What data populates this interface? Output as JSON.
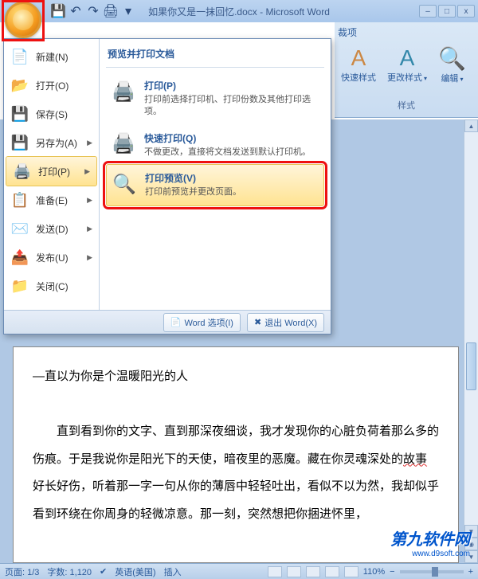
{
  "window": {
    "title": "如果你又是一抹回忆.docx - Microsoft Word"
  },
  "ribbon": {
    "tab_label": "裁项",
    "quick_styles": "快速样式",
    "change_styles": "更改样式",
    "edit": "编辑",
    "group_label": "样式"
  },
  "office_menu": {
    "items": [
      {
        "label": "新建(N)",
        "icon": "new-doc-icon"
      },
      {
        "label": "打开(O)",
        "icon": "open-folder-icon"
      },
      {
        "label": "保存(S)",
        "icon": "save-icon"
      },
      {
        "label": "另存为(A)",
        "icon": "save-as-icon"
      },
      {
        "label": "打印(P)",
        "icon": "print-icon"
      },
      {
        "label": "准备(E)",
        "icon": "prepare-icon"
      },
      {
        "label": "发送(D)",
        "icon": "send-icon"
      },
      {
        "label": "发布(U)",
        "icon": "publish-icon"
      },
      {
        "label": "关闭(C)",
        "icon": "close-doc-icon"
      }
    ],
    "right_header": "预览并打印文档",
    "sub_items": [
      {
        "title": "打印(P)",
        "desc": "打印前选择打印机、打印份数及其他打印选项。"
      },
      {
        "title": "快速打印(Q)",
        "desc": "不做更改，直接将文档发送到默认打印机。"
      },
      {
        "title": "打印预览(V)",
        "desc": "打印前预览并更改页面。"
      }
    ],
    "footer": {
      "options": "Word 选项(I)",
      "exit": "退出 Word(X)"
    }
  },
  "document": {
    "line1": "—直以为你是个温暖阳光的人",
    "body": "　　直到看到你的文字、直到那深夜细谈，我才发现你的心脏负荷着那么多的伤痕。于是我说你是阳光下的天使，暗夜里的恶魔。藏在你灵魂深处的",
    "body_u1": "故事",
    "body2": "好长好伤，听着那一字一句从你的薄唇中轻轻吐出，看似不以为然，我却似乎看到环绕在你周身的轻微凉意。那一刻，突然想把你捆进怀里，"
  },
  "statusbar": {
    "page": "页面: 1/3",
    "words": "字数: 1,120",
    "lang": "英语(美国)",
    "mode": "插入",
    "zoom": "110%"
  },
  "watermark": {
    "big": "第九软件网",
    "small": "www.d9soft.com"
  },
  "colors": {
    "highlight_red": "#e11"
  }
}
